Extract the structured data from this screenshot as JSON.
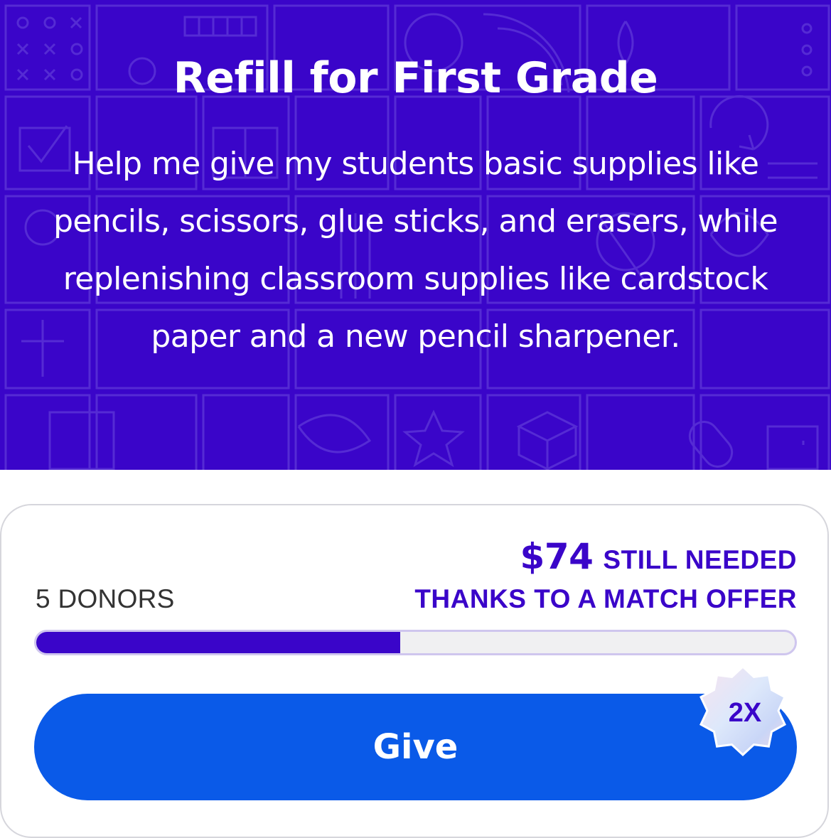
{
  "hero": {
    "title": "Refill for First Grade",
    "description": "Help me give my students basic supplies like pencils, scissors, glue sticks, and erasers, while replenishing classroom supplies like cardstock paper and a new pencil sharpener.",
    "background_color": "#3a05c9"
  },
  "funding": {
    "donors_label": "5 DONORS",
    "amount": "$74",
    "still_needed_label": "STILL NEEDED",
    "match_label": "THANKS TO A MATCH OFFER",
    "progress_fraction": 0.48,
    "accent_color": "#3a05c9"
  },
  "give_button": {
    "label": "Give",
    "color": "#0a5ae8"
  },
  "match_badge": {
    "label": "2X",
    "icon": "starburst-badge-icon"
  }
}
